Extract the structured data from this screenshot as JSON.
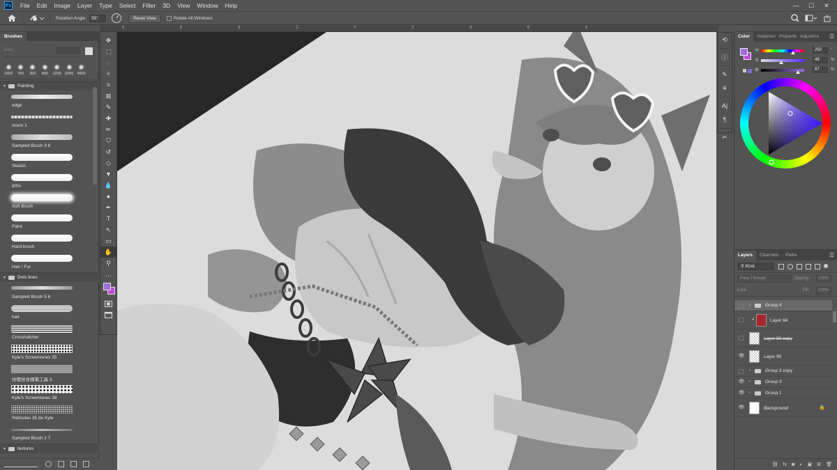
{
  "app": {
    "logo": "Ps"
  },
  "menu": [
    "File",
    "Edit",
    "Image",
    "Layer",
    "Type",
    "Select",
    "Filter",
    "3D",
    "View",
    "Window",
    "Help"
  ],
  "window_controls": {
    "minimize": "—",
    "maximize": "☐",
    "close": "✕"
  },
  "options": {
    "rotation_label": "Rotation Angle:",
    "rotation_value": "55°",
    "reset_view": "Reset View",
    "rotate_all_windows": "Rotate All Windows"
  },
  "ruler": {
    "ticks": [
      "8",
      "6",
      "4",
      "2",
      "0",
      "2",
      "4",
      "6",
      "8"
    ]
  },
  "brushes": {
    "tab": "Brushes",
    "size_label": "Size:",
    "tip_sizes": [
      "1600",
      "700",
      "300",
      "800",
      "1200",
      "3200",
      "4600"
    ],
    "folders": [
      {
        "name": "Painting",
        "items": [
          "edge",
          "moon 1",
          "Sampled Brush 3 8",
          "Sketch",
          "80%",
          "Soft Brush",
          "Paint",
          "Hard brush",
          "Hair / Fur"
        ]
      },
      {
        "name": "Dots lines",
        "items": [
          "Sampled Brush 5 6",
          "hair",
          "Crosshatcher",
          "Kyle's Screentones 35",
          "纹理丝合画笔工具 3",
          "Kyle's Screentones 38",
          "Retículas 35 de Kyle",
          "Sampled Brush 2 7"
        ]
      },
      {
        "name": "textures",
        "items": []
      }
    ]
  },
  "tools": [
    "move-icon",
    "marquee-icon",
    "lasso-icon",
    "magic-wand-icon",
    "crop-icon",
    "frame-icon",
    "eyedropper-icon",
    "healing-icon",
    "brush-icon",
    "stamp-icon",
    "history-brush-icon",
    "eraser-icon",
    "bucket-icon",
    "blur-icon",
    "dodge-icon",
    "pen-icon",
    "type-icon",
    "path-select-icon",
    "shape-icon",
    "hand-icon",
    "zoom-icon",
    "more-icon"
  ],
  "tool_glyphs": [
    "✥",
    "⬚",
    "◌",
    "✧",
    "⌗",
    "⊠",
    "✎",
    "✚",
    "✏",
    "⛉",
    "↺",
    "◇",
    "▼",
    "💧",
    "●",
    "✒",
    "T",
    "↖",
    "▭",
    "✋",
    "⚲",
    "…"
  ],
  "colors": {
    "foreground": "#9e6cdc",
    "background": "#c548e0"
  },
  "color_panel": {
    "tabs": [
      "Color",
      "Swatches",
      "Properties",
      "Adjustments"
    ],
    "h_label": "H",
    "s_label": "S",
    "b_label": "B",
    "h_value": "250",
    "s_value": "48",
    "b_value": "87",
    "h_unit": "°",
    "s_unit": "%",
    "b_unit": "%"
  },
  "layers_panel": {
    "tabs": [
      "Layers",
      "Channels",
      "Paths"
    ],
    "kind_label": "Kind",
    "blend_mode": "Pass Through",
    "opacity_label": "Opacity:",
    "opacity_value": "100%",
    "lock_label": "Lock:",
    "fill_label": "Fill:",
    "fill_value": "100%",
    "layers": [
      {
        "name": "Group 4",
        "type": "group",
        "visible": false,
        "selected": true
      },
      {
        "name": "Layer 84",
        "type": "layer",
        "visible": false,
        "selected": false,
        "clipped": true,
        "thumb_color": "#a8242c"
      },
      {
        "name": "Layer 90 copy",
        "type": "layer",
        "visible": false,
        "selected": false,
        "strike": true
      },
      {
        "name": "Layer 90",
        "type": "layer",
        "visible": true,
        "selected": false
      },
      {
        "name": "Group 3 copy",
        "type": "group",
        "visible": false,
        "selected": false
      },
      {
        "name": "Group 3",
        "type": "group",
        "visible": true,
        "selected": false
      },
      {
        "name": "Group 1",
        "type": "group",
        "visible": true,
        "selected": false
      },
      {
        "name": "Background",
        "type": "background",
        "visible": true,
        "selected": false,
        "locked": true
      }
    ],
    "bottom_icons": [
      "link-icon",
      "fx-icon",
      "mask-icon",
      "adjustment-icon",
      "new-group-icon",
      "new-layer-icon",
      "trash-icon"
    ],
    "bottom_glyphs": [
      "⛓",
      "fx",
      "◙",
      "◐",
      "▣",
      "⊞",
      "🗑"
    ]
  }
}
